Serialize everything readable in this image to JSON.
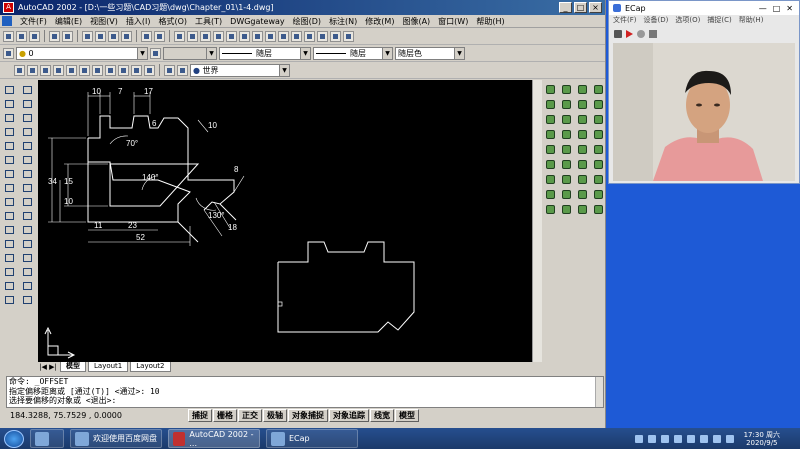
{
  "acad": {
    "title": "AutoCAD 2002 - [D:\\一些习题\\CAD习题\\dwg\\Chapter_01\\1-4.dwg]",
    "menu": [
      "文件(F)",
      "编辑(E)",
      "视图(V)",
      "插入(I)",
      "格式(O)",
      "工具(T)",
      "DWGgateway",
      "绘图(D)",
      "标注(N)",
      "修改(M)",
      "图像(A)",
      "窗口(W)",
      "帮助(H)"
    ],
    "layer_value": "0",
    "linetype_1": "随层",
    "linetype_2": "随层",
    "color_value": "随层色",
    "ucs_value": "世界",
    "layout_tabs": [
      "模型",
      "Layout1",
      "Layout2"
    ],
    "command_lines": [
      "命令: _OFFSET",
      "指定偏移距离或 [通过(T)] <通过>: 10",
      "选择要偏移的对象或 <退出>:"
    ],
    "coords": "184.3288, 75.7529 , 0.0000",
    "status_buttons": [
      "捕捉",
      "栅格",
      "正交",
      "极轴",
      "对象捕捉",
      "对象追踪",
      "线宽",
      "模型"
    ],
    "dimensions": {
      "d10_top": "10",
      "d7_top": "7",
      "d17_top": "17",
      "d6": "6",
      "d10_right": "10",
      "a70": "70°",
      "d34": "34",
      "d15": "15",
      "d10_left": "10",
      "a140": "140°",
      "d8": "8",
      "a130": "130°",
      "d18": "18",
      "d11": "11",
      "d23": "23",
      "d52": "52"
    }
  },
  "ecap": {
    "title": "ECap",
    "menu": [
      "文件(F)",
      "设备(D)",
      "选项(O)",
      "捕捉(C)",
      "帮助(H)"
    ]
  },
  "taskbar": {
    "buttons": [
      "欢迎使用百度网盘",
      "AutoCAD 2002 - ...",
      "ECap"
    ],
    "time": "17:30 周六",
    "date": "2020/9/5"
  }
}
